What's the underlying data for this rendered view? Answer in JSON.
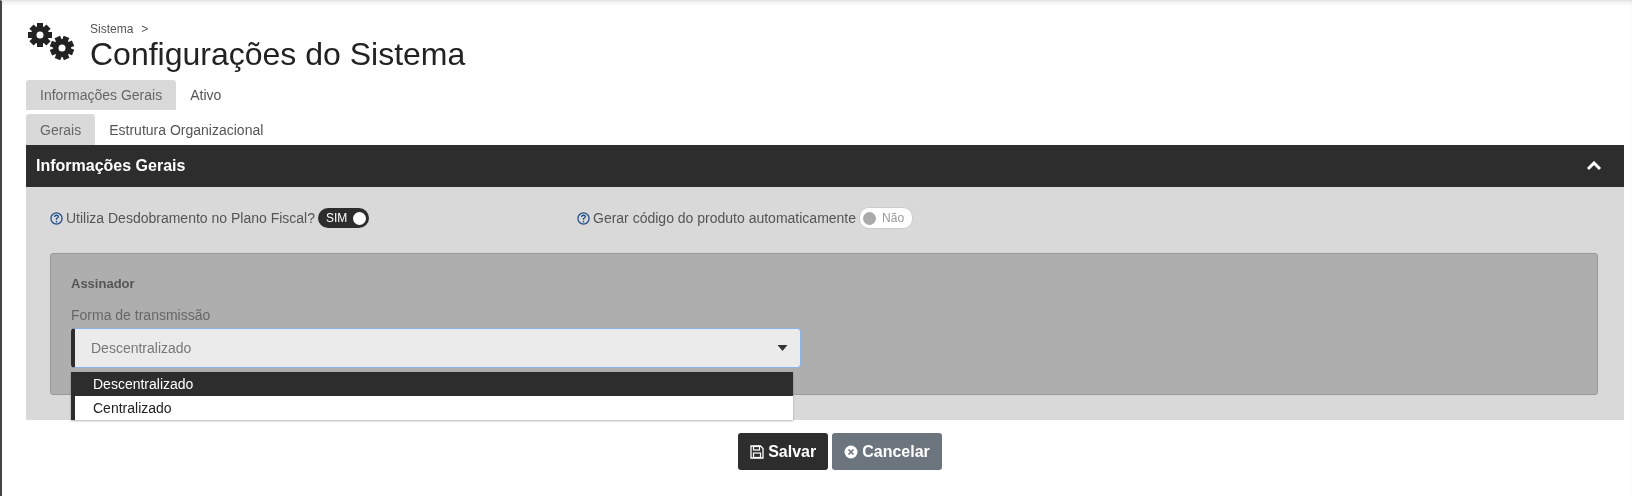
{
  "breadcrumb": {
    "label": "Sistema",
    "separator": ">"
  },
  "title": "Configurações do Sistema",
  "tabs": [
    {
      "label": "Informações Gerais",
      "selected": true
    },
    {
      "label": "Ativo",
      "selected": false
    }
  ],
  "subtabs": [
    {
      "label": "Gerais",
      "selected": true
    },
    {
      "label": "Estrutura Organizacional",
      "selected": false
    }
  ],
  "section": {
    "title": "Informações Gerais",
    "expanded": true
  },
  "toggles": [
    {
      "label": "Utiliza Desdobramento no Plano Fiscal?",
      "on": true,
      "text": "SIM"
    },
    {
      "label": "Gerar código do produto automaticamente",
      "on": false,
      "text": "Não"
    }
  ],
  "signer": {
    "title": "Assinador",
    "field_label": "Forma de transmissão",
    "value": "Descentralizado",
    "options": [
      {
        "label": "Descentralizado",
        "selected": true
      },
      {
        "label": "Centralizado",
        "selected": false
      }
    ]
  },
  "buttons": [
    {
      "label": "Salvar",
      "kind": "primary"
    },
    {
      "label": "Cancelar",
      "kind": "secondary"
    }
  ]
}
